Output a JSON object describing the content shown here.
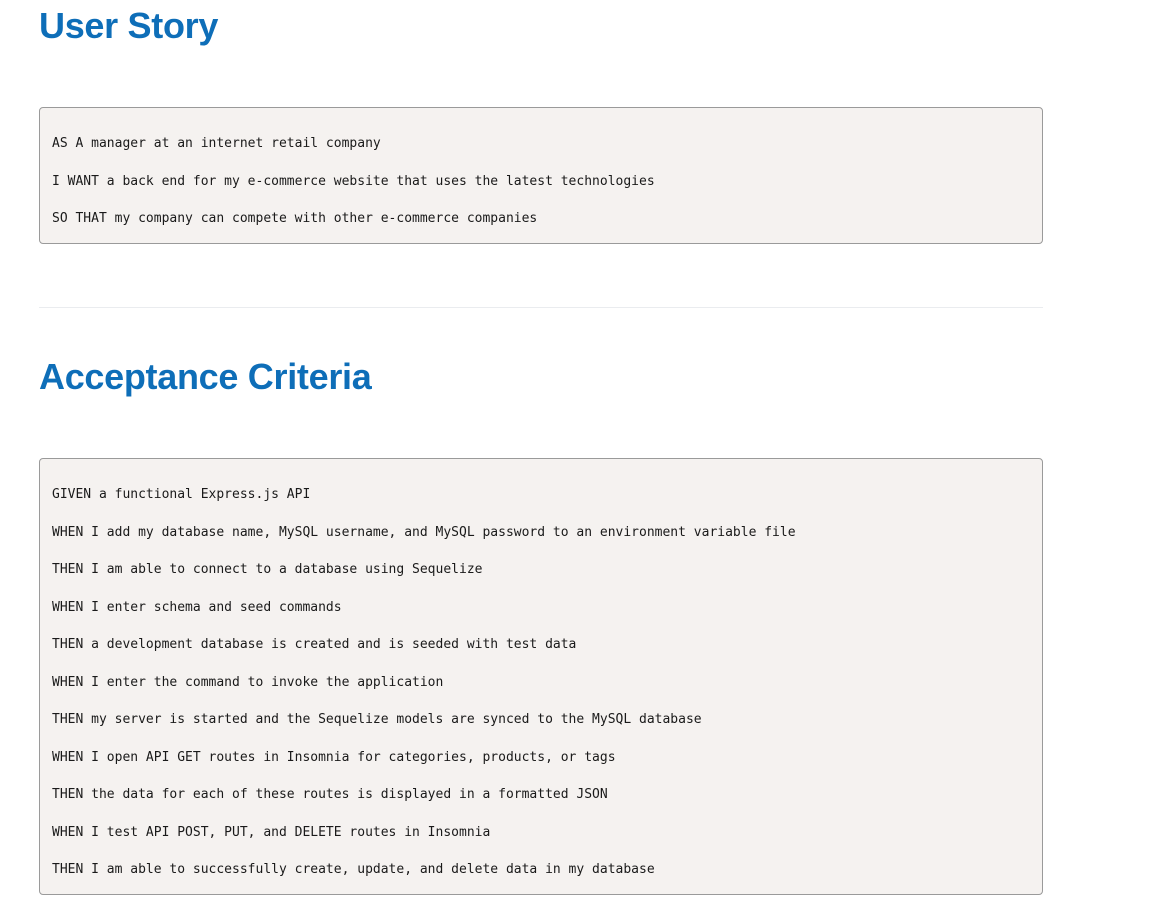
{
  "user_story": {
    "title": "User Story",
    "lines": [
      "AS A manager at an internet retail company",
      "I WANT a back end for my e-commerce website that uses the latest technologies",
      "SO THAT my company can compete with other e-commerce companies"
    ]
  },
  "acceptance_criteria": {
    "title": "Acceptance Criteria",
    "lines": [
      "GIVEN a functional Express.js API",
      "WHEN I add my database name, MySQL username, and MySQL password to an environment variable file",
      "THEN I am able to connect to a database using Sequelize",
      "WHEN I enter schema and seed commands",
      "THEN a development database is created and is seeded with test data",
      "WHEN I enter the command to invoke the application",
      "THEN my server is started and the Sequelize models are synced to the MySQL database",
      "WHEN I open API GET routes in Insomnia for categories, products, or tags",
      "THEN the data for each of these routes is displayed in a formatted JSON",
      "WHEN I test API POST, PUT, and DELETE routes in Insomnia",
      "THEN I am able to successfully create, update, and delete data in my database"
    ]
  },
  "colors": {
    "heading": "#0e6eb8",
    "code_background": "#f5f2f0",
    "code_border": "#9a9a9a",
    "divider": "#eaecef"
  }
}
